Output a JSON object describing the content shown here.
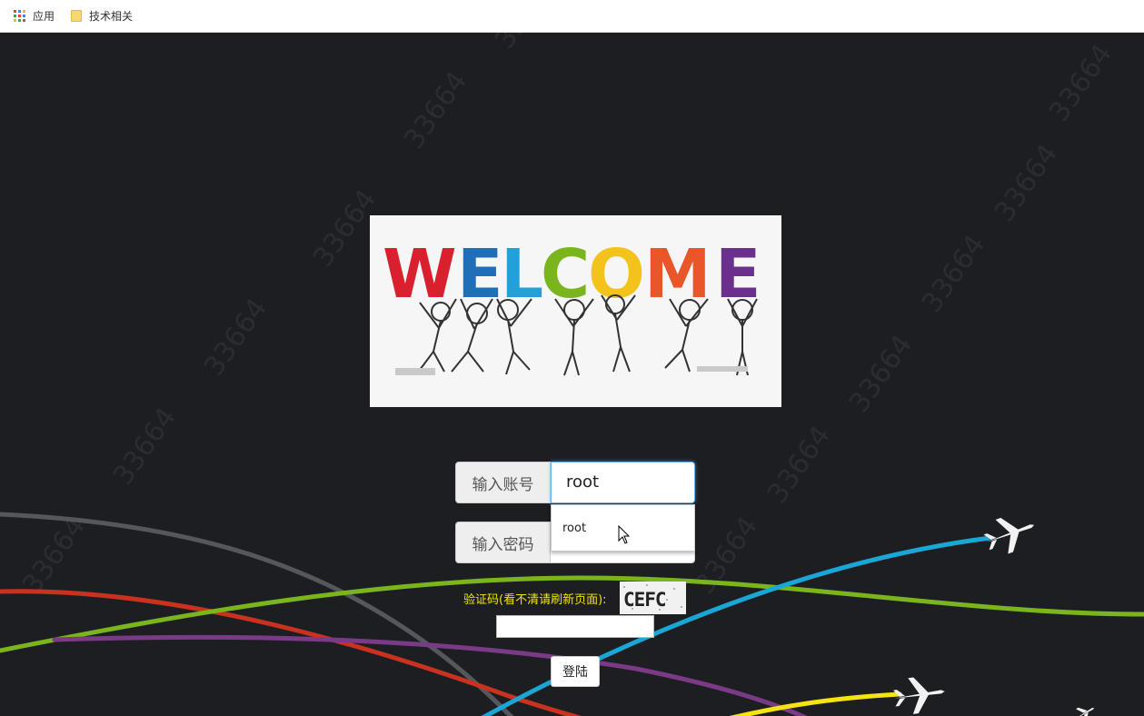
{
  "bookmarks": {
    "items": [
      {
        "label": "应用",
        "icon": "apps-grid-icon"
      },
      {
        "label": "技术相关",
        "icon": "folder-icon"
      }
    ]
  },
  "welcome_image": {
    "text": "WELCOME"
  },
  "watermark": "33664",
  "login": {
    "account_label": "输入账号",
    "account_value": "root",
    "autocomplete_suggestion": "root",
    "password_label": "输入密码",
    "password_value": "",
    "captcha_label": "验证码(看不清请刷新页面):",
    "captcha_text": "CEFC",
    "captcha_value": "",
    "submit_label": "登陆"
  },
  "colors": {
    "background": "#1d1e22",
    "captcha_label": "#f2e600",
    "input_focus": "#66afe9"
  }
}
